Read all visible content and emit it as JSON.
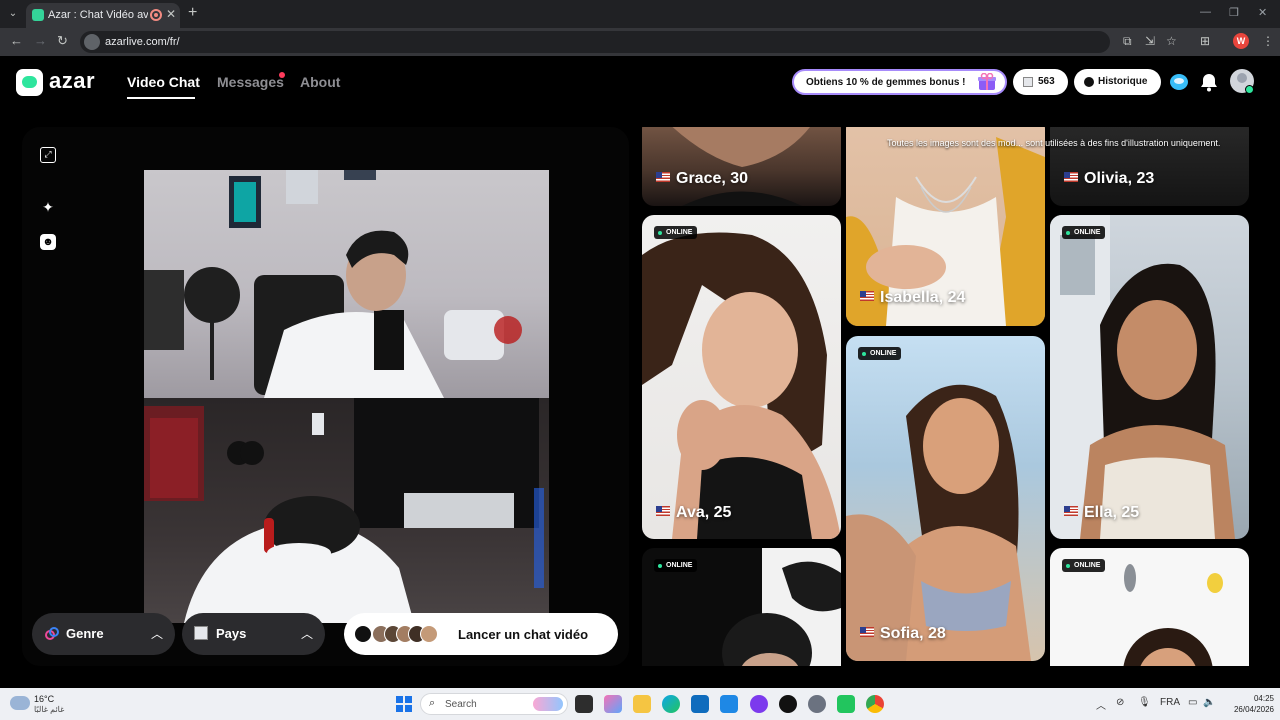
{
  "browser": {
    "tab_title": "Azar : Chat Vidéo avec de n",
    "url": "azarlive.com/fr/",
    "profile_initial": "W"
  },
  "header": {
    "logo": "azar",
    "nav": {
      "video_chat": "Video Chat",
      "messages": "Messages",
      "about": "About"
    },
    "bonus_label": "Obtiens 10 % de gemmes bonus !",
    "gems_count": "563",
    "history_label": "Historique"
  },
  "video": {
    "genre_label": "Genre",
    "pays_label": "Pays",
    "launch_label": "Lancer un chat vidéo"
  },
  "grid": {
    "disclaimer": "Toutes les images sont des mod... sont utilisées à des fins d'illustration uniquement.",
    "online_label": "ONLINE",
    "cards": [
      {
        "name": "Grace, 30"
      },
      {
        "name": "Isabella, 24"
      },
      {
        "name": "Olivia, 23"
      },
      {
        "name": "Ava, 25"
      },
      {
        "name": "Sofia, 28"
      },
      {
        "name": "Ella, 25"
      }
    ]
  },
  "taskbar": {
    "temperature": "16°C",
    "weather_desc": "غائم غالبًا",
    "search_label": "Search",
    "language": "FRA",
    "time": "04:25",
    "date": "26/04/2026"
  },
  "colors": {
    "accent": "#2ee59d",
    "notification": "#ff3b5c",
    "bonus_border": "#a78bfa"
  }
}
